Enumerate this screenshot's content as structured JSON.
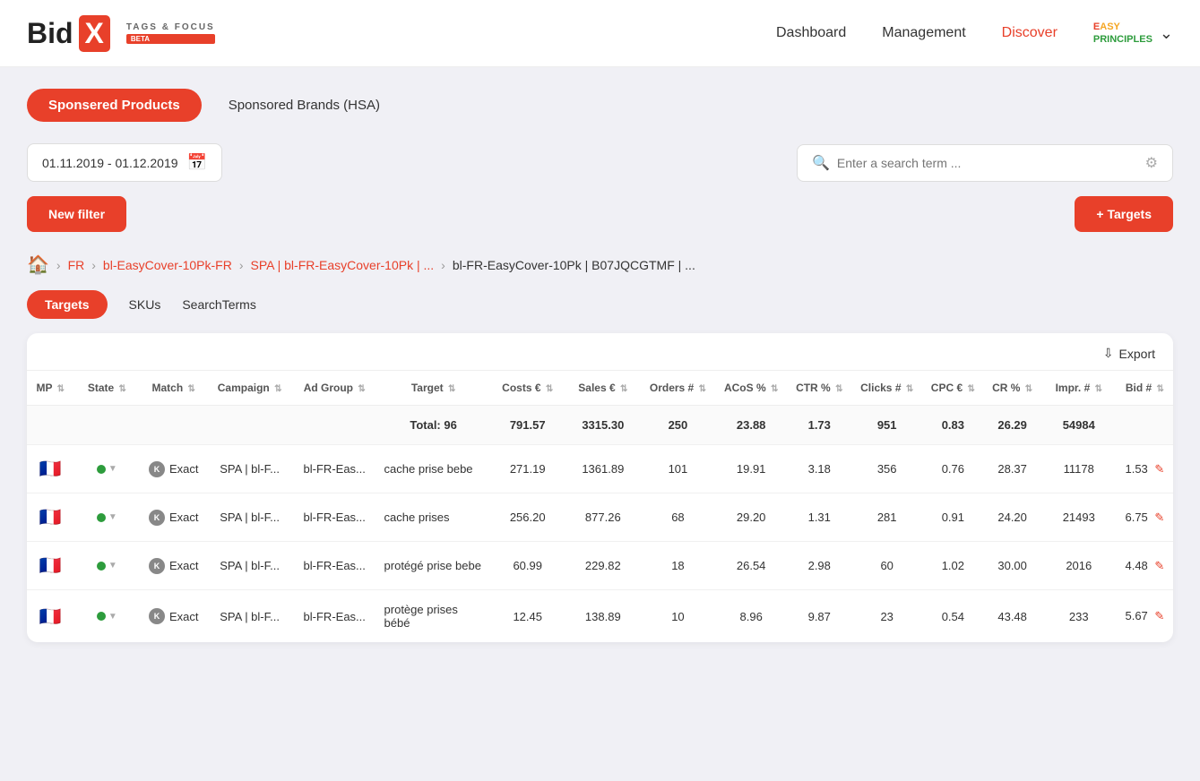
{
  "header": {
    "logo_bid": "Bid",
    "logo_x": "X",
    "logo_tags": "TAGS & FOCUS",
    "logo_beta": "BETA",
    "nav": {
      "dashboard": "Dashboard",
      "management": "Management",
      "discover": "Discover"
    },
    "easy_principles": "EASY PRINCIPLES"
  },
  "tabs": {
    "sponsored_products": "Sponsered Products",
    "sponsored_brands": "Sponsored Brands (HSA)"
  },
  "filter": {
    "date_range": "01.11.2019 - 01.12.2019",
    "search_placeholder": "Enter a search term ..."
  },
  "actions": {
    "new_filter": "New filter",
    "targets": "+ Targets"
  },
  "breadcrumb": {
    "home_icon": "🏠",
    "fr": "FR",
    "campaign": "bl-EasyCover-10Pk-FR",
    "adgroup": "SPA | bl-FR-EasyCover-10Pk | ...",
    "current": "bl-FR-EasyCover-10Pk | B07JQCGTMF | ..."
  },
  "sub_tabs": {
    "targets": "Targets",
    "skus": "SKUs",
    "search_terms": "SearchTerms"
  },
  "export": {
    "label": "Export"
  },
  "table": {
    "columns": [
      "MP",
      "State",
      "Match",
      "Campaign",
      "Ad Group",
      "Target",
      "Costs €",
      "Sales €",
      "Orders #",
      "ACoS %",
      "CTR %",
      "Clicks #",
      "CPC €",
      "CR %",
      "Impr. #",
      "Bid #"
    ],
    "total": {
      "label": "Total: 96",
      "costs": "791.57",
      "sales": "3315.30",
      "orders": "250",
      "acos": "23.88",
      "ctr": "1.73",
      "clicks": "951",
      "cpc": "0.83",
      "cr": "26.29",
      "impr": "54984",
      "bid": ""
    },
    "rows": [
      {
        "flag": "🇫🇷",
        "match": "Exact",
        "campaign": "SPA | bl-F...",
        "adgroup": "bl-FR-Eas...",
        "target": "cache prise bebe",
        "costs": "271.19",
        "sales": "1361.89",
        "orders": "101",
        "acos": "19.91",
        "ctr": "3.18",
        "clicks": "356",
        "cpc": "0.76",
        "cr": "28.37",
        "impr": "11178",
        "bid": "1.53"
      },
      {
        "flag": "🇫🇷",
        "match": "Exact",
        "campaign": "SPA | bl-F...",
        "adgroup": "bl-FR-Eas...",
        "target": "cache prises",
        "costs": "256.20",
        "sales": "877.26",
        "orders": "68",
        "acos": "29.20",
        "ctr": "1.31",
        "clicks": "281",
        "cpc": "0.91",
        "cr": "24.20",
        "impr": "21493",
        "bid": "6.75"
      },
      {
        "flag": "🇫🇷",
        "match": "Exact",
        "campaign": "SPA | bl-F...",
        "adgroup": "bl-FR-Eas...",
        "target": "protégé prise bebe",
        "costs": "60.99",
        "sales": "229.82",
        "orders": "18",
        "acos": "26.54",
        "ctr": "2.98",
        "clicks": "60",
        "cpc": "1.02",
        "cr": "30.00",
        "impr": "2016",
        "bid": "4.48"
      },
      {
        "flag": "🇫🇷",
        "match": "Exact",
        "campaign": "SPA | bl-F...",
        "adgroup": "bl-FR-Eas...",
        "target": "protège prises bébé",
        "costs": "12.45",
        "sales": "138.89",
        "orders": "10",
        "acos": "8.96",
        "ctr": "9.87",
        "clicks": "23",
        "cpc": "0.54",
        "cr": "43.48",
        "impr": "233",
        "bid": "5.67"
      }
    ]
  }
}
